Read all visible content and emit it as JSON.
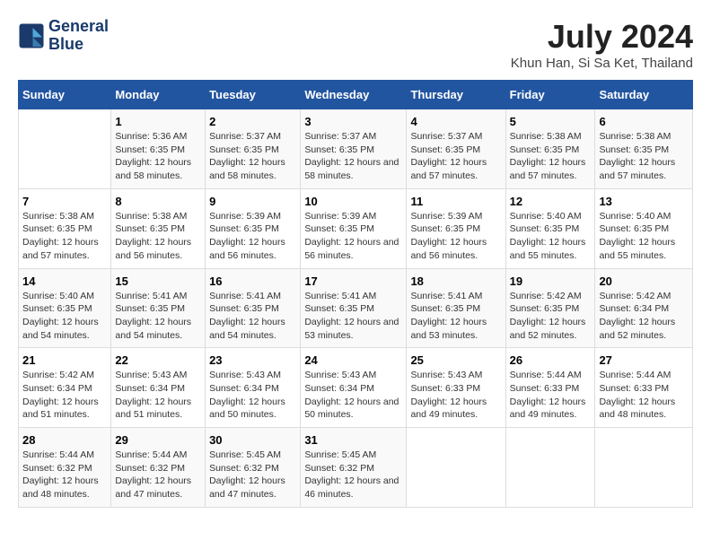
{
  "logo": {
    "line1": "General",
    "line2": "Blue"
  },
  "title": "July 2024",
  "subtitle": "Khun Han, Si Sa Ket, Thailand",
  "days_header": [
    "Sunday",
    "Monday",
    "Tuesday",
    "Wednesday",
    "Thursday",
    "Friday",
    "Saturday"
  ],
  "weeks": [
    [
      {
        "day": "",
        "sunrise": "",
        "sunset": "",
        "daylight": ""
      },
      {
        "day": "1",
        "sunrise": "Sunrise: 5:36 AM",
        "sunset": "Sunset: 6:35 PM",
        "daylight": "Daylight: 12 hours and 58 minutes."
      },
      {
        "day": "2",
        "sunrise": "Sunrise: 5:37 AM",
        "sunset": "Sunset: 6:35 PM",
        "daylight": "Daylight: 12 hours and 58 minutes."
      },
      {
        "day": "3",
        "sunrise": "Sunrise: 5:37 AM",
        "sunset": "Sunset: 6:35 PM",
        "daylight": "Daylight: 12 hours and 58 minutes."
      },
      {
        "day": "4",
        "sunrise": "Sunrise: 5:37 AM",
        "sunset": "Sunset: 6:35 PM",
        "daylight": "Daylight: 12 hours and 57 minutes."
      },
      {
        "day": "5",
        "sunrise": "Sunrise: 5:38 AM",
        "sunset": "Sunset: 6:35 PM",
        "daylight": "Daylight: 12 hours and 57 minutes."
      },
      {
        "day": "6",
        "sunrise": "Sunrise: 5:38 AM",
        "sunset": "Sunset: 6:35 PM",
        "daylight": "Daylight: 12 hours and 57 minutes."
      }
    ],
    [
      {
        "day": "7",
        "sunrise": "Sunrise: 5:38 AM",
        "sunset": "Sunset: 6:35 PM",
        "daylight": "Daylight: 12 hours and 57 minutes."
      },
      {
        "day": "8",
        "sunrise": "Sunrise: 5:38 AM",
        "sunset": "Sunset: 6:35 PM",
        "daylight": "Daylight: 12 hours and 56 minutes."
      },
      {
        "day": "9",
        "sunrise": "Sunrise: 5:39 AM",
        "sunset": "Sunset: 6:35 PM",
        "daylight": "Daylight: 12 hours and 56 minutes."
      },
      {
        "day": "10",
        "sunrise": "Sunrise: 5:39 AM",
        "sunset": "Sunset: 6:35 PM",
        "daylight": "Daylight: 12 hours and 56 minutes."
      },
      {
        "day": "11",
        "sunrise": "Sunrise: 5:39 AM",
        "sunset": "Sunset: 6:35 PM",
        "daylight": "Daylight: 12 hours and 56 minutes."
      },
      {
        "day": "12",
        "sunrise": "Sunrise: 5:40 AM",
        "sunset": "Sunset: 6:35 PM",
        "daylight": "Daylight: 12 hours and 55 minutes."
      },
      {
        "day": "13",
        "sunrise": "Sunrise: 5:40 AM",
        "sunset": "Sunset: 6:35 PM",
        "daylight": "Daylight: 12 hours and 55 minutes."
      }
    ],
    [
      {
        "day": "14",
        "sunrise": "Sunrise: 5:40 AM",
        "sunset": "Sunset: 6:35 PM",
        "daylight": "Daylight: 12 hours and 54 minutes."
      },
      {
        "day": "15",
        "sunrise": "Sunrise: 5:41 AM",
        "sunset": "Sunset: 6:35 PM",
        "daylight": "Daylight: 12 hours and 54 minutes."
      },
      {
        "day": "16",
        "sunrise": "Sunrise: 5:41 AM",
        "sunset": "Sunset: 6:35 PM",
        "daylight": "Daylight: 12 hours and 54 minutes."
      },
      {
        "day": "17",
        "sunrise": "Sunrise: 5:41 AM",
        "sunset": "Sunset: 6:35 PM",
        "daylight": "Daylight: 12 hours and 53 minutes."
      },
      {
        "day": "18",
        "sunrise": "Sunrise: 5:41 AM",
        "sunset": "Sunset: 6:35 PM",
        "daylight": "Daylight: 12 hours and 53 minutes."
      },
      {
        "day": "19",
        "sunrise": "Sunrise: 5:42 AM",
        "sunset": "Sunset: 6:35 PM",
        "daylight": "Daylight: 12 hours and 52 minutes."
      },
      {
        "day": "20",
        "sunrise": "Sunrise: 5:42 AM",
        "sunset": "Sunset: 6:34 PM",
        "daylight": "Daylight: 12 hours and 52 minutes."
      }
    ],
    [
      {
        "day": "21",
        "sunrise": "Sunrise: 5:42 AM",
        "sunset": "Sunset: 6:34 PM",
        "daylight": "Daylight: 12 hours and 51 minutes."
      },
      {
        "day": "22",
        "sunrise": "Sunrise: 5:43 AM",
        "sunset": "Sunset: 6:34 PM",
        "daylight": "Daylight: 12 hours and 51 minutes."
      },
      {
        "day": "23",
        "sunrise": "Sunrise: 5:43 AM",
        "sunset": "Sunset: 6:34 PM",
        "daylight": "Daylight: 12 hours and 50 minutes."
      },
      {
        "day": "24",
        "sunrise": "Sunrise: 5:43 AM",
        "sunset": "Sunset: 6:34 PM",
        "daylight": "Daylight: 12 hours and 50 minutes."
      },
      {
        "day": "25",
        "sunrise": "Sunrise: 5:43 AM",
        "sunset": "Sunset: 6:33 PM",
        "daylight": "Daylight: 12 hours and 49 minutes."
      },
      {
        "day": "26",
        "sunrise": "Sunrise: 5:44 AM",
        "sunset": "Sunset: 6:33 PM",
        "daylight": "Daylight: 12 hours and 49 minutes."
      },
      {
        "day": "27",
        "sunrise": "Sunrise: 5:44 AM",
        "sunset": "Sunset: 6:33 PM",
        "daylight": "Daylight: 12 hours and 48 minutes."
      }
    ],
    [
      {
        "day": "28",
        "sunrise": "Sunrise: 5:44 AM",
        "sunset": "Sunset: 6:32 PM",
        "daylight": "Daylight: 12 hours and 48 minutes."
      },
      {
        "day": "29",
        "sunrise": "Sunrise: 5:44 AM",
        "sunset": "Sunset: 6:32 PM",
        "daylight": "Daylight: 12 hours and 47 minutes."
      },
      {
        "day": "30",
        "sunrise": "Sunrise: 5:45 AM",
        "sunset": "Sunset: 6:32 PM",
        "daylight": "Daylight: 12 hours and 47 minutes."
      },
      {
        "day": "31",
        "sunrise": "Sunrise: 5:45 AM",
        "sunset": "Sunset: 6:32 PM",
        "daylight": "Daylight: 12 hours and 46 minutes."
      },
      {
        "day": "",
        "sunrise": "",
        "sunset": "",
        "daylight": ""
      },
      {
        "day": "",
        "sunrise": "",
        "sunset": "",
        "daylight": ""
      },
      {
        "day": "",
        "sunrise": "",
        "sunset": "",
        "daylight": ""
      }
    ]
  ]
}
